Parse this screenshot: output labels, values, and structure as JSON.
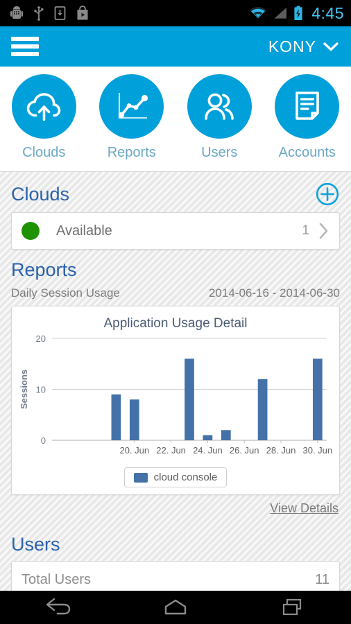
{
  "statusbar": {
    "time": "4:45",
    "icons_left": [
      "android-debug-icon",
      "usb-icon",
      "download-icon",
      "play-store-icon"
    ],
    "icons_right": [
      "wifi-icon",
      "cellular-signal-icon",
      "battery-charging-icon"
    ],
    "accent": "#44c8f5"
  },
  "appbar": {
    "menu_icon": "hamburger-menu-icon",
    "brand": "KONY",
    "dropdown_icon": "chevron-down-icon",
    "background": "#00a0da"
  },
  "navtiles": [
    {
      "label": "Clouds",
      "icon": "cloud-upload-icon"
    },
    {
      "label": "Reports",
      "icon": "line-chart-icon"
    },
    {
      "label": "Users",
      "icon": "users-icon"
    },
    {
      "label": "Accounts",
      "icon": "document-icon"
    }
  ],
  "clouds": {
    "heading": "Clouds",
    "add_icon": "plus-circle-icon",
    "rows": [
      {
        "status": "Available",
        "status_color": "#1f9203",
        "count": "1",
        "chevron": "chevron-right-icon"
      }
    ]
  },
  "reports": {
    "heading": "Reports",
    "subtitle": "Daily Session Usage",
    "date_range": "2014-06-16 - 2014-06-30",
    "view_details": "View Details"
  },
  "users": {
    "heading": "Users",
    "row_label": "Total Users",
    "row_count": "11"
  },
  "navbar": {
    "back": "back-icon",
    "home": "home-icon",
    "recents": "recents-icon"
  },
  "chart_data": {
    "type": "bar",
    "title": "Application Usage Detail",
    "xlabel": "",
    "ylabel": "Sessions",
    "ylim": [
      0,
      20
    ],
    "yticks": [
      0,
      10,
      20
    ],
    "xticks": [
      "20. Jun",
      "22. Jun",
      "24. Jun",
      "26. Jun",
      "28. Jun",
      "30. Jun"
    ],
    "grid": true,
    "legend_position": "bottom",
    "series": [
      {
        "name": "cloud console",
        "color": "#4472a8",
        "categories": [
          "16. Jun",
          "17. Jun",
          "18. Jun",
          "19. Jun",
          "20. Jun",
          "21. Jun",
          "22. Jun",
          "23. Jun",
          "24. Jun",
          "25. Jun",
          "26. Jun",
          "27. Jun",
          "28. Jun",
          "29. Jun",
          "30. Jun"
        ],
        "values": [
          0,
          0,
          0,
          9,
          8,
          0,
          0,
          16,
          1,
          2,
          0,
          12,
          0,
          0,
          16
        ]
      }
    ]
  }
}
